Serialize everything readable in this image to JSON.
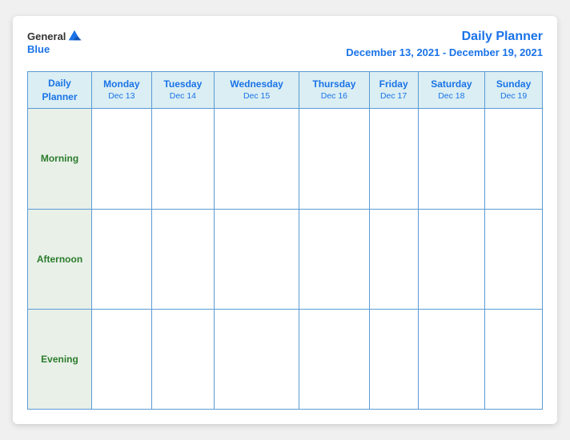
{
  "header": {
    "logo": {
      "general": "General",
      "blue": "Blue",
      "icon_label": "general-blue-logo"
    },
    "title": "Daily Planner",
    "date_range": "December 13, 2021 - December 19, 2021"
  },
  "table": {
    "header_row": {
      "col0_line1": "Daily",
      "col0_line2": "Planner",
      "days": [
        {
          "name": "Monday",
          "date": "Dec 13"
        },
        {
          "name": "Tuesday",
          "date": "Dec 14"
        },
        {
          "name": "Wednesday",
          "date": "Dec 15"
        },
        {
          "name": "Thursday",
          "date": "Dec 16"
        },
        {
          "name": "Friday",
          "date": "Dec 17"
        },
        {
          "name": "Saturday",
          "date": "Dec 18"
        },
        {
          "name": "Sunday",
          "date": "Dec 19"
        }
      ]
    },
    "time_slots": [
      "Morning",
      "Afternoon",
      "Evening"
    ]
  }
}
